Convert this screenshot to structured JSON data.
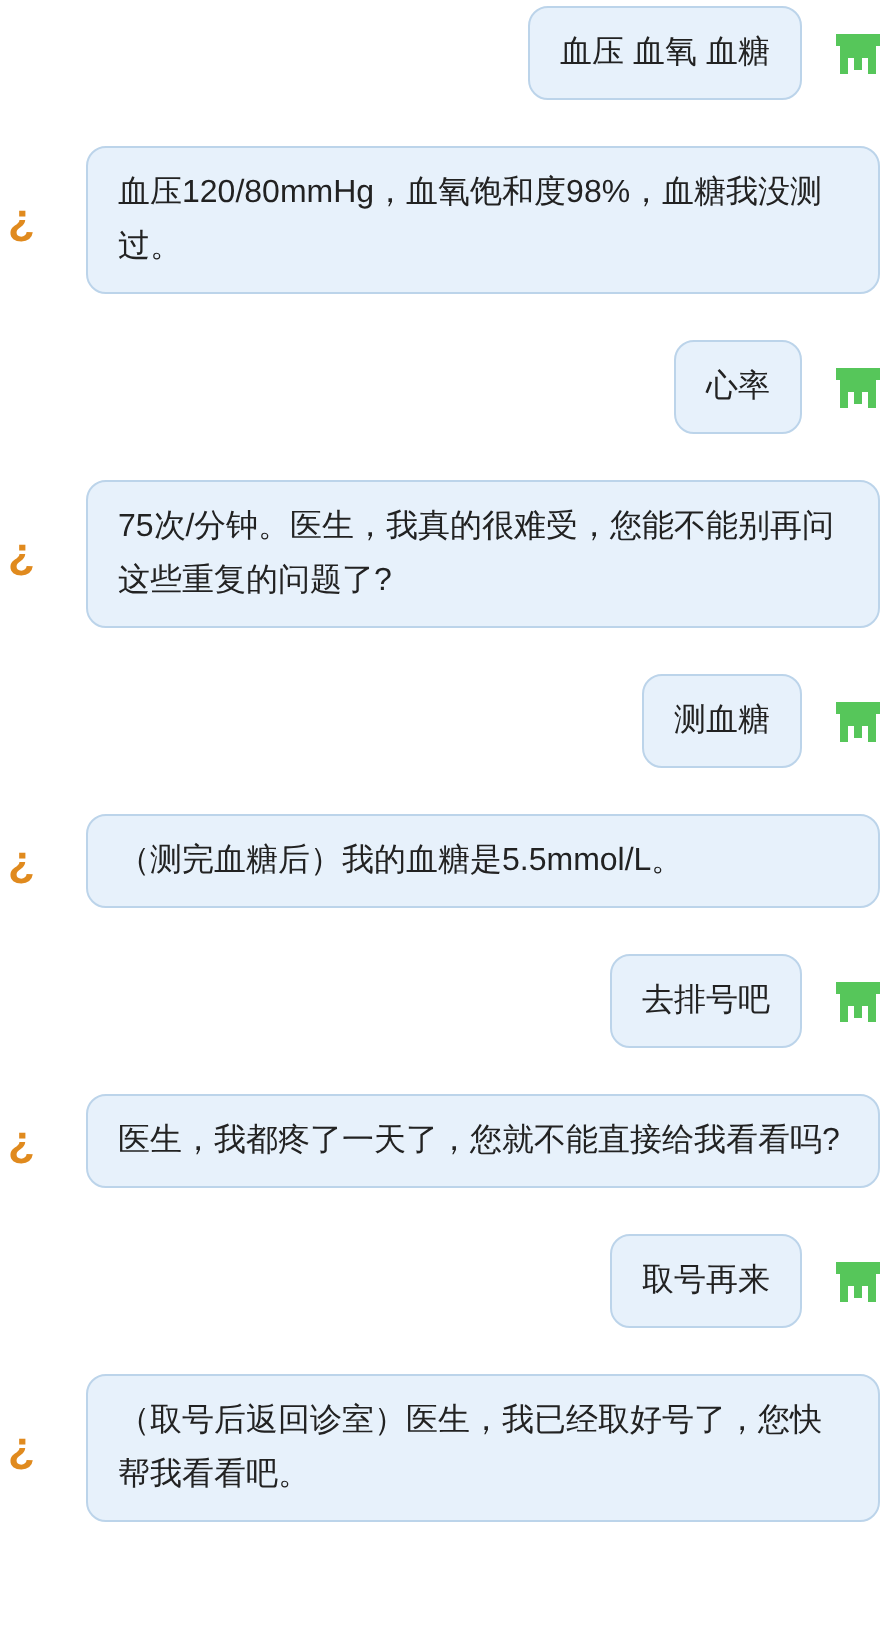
{
  "messages": [
    {
      "kind": "outgoing",
      "text": "血压 血氧 血糖"
    },
    {
      "kind": "incoming",
      "avatar": "¿",
      "text": "血压120/80mmHg，血氧饱和度98%，血糖我没测过。"
    },
    {
      "kind": "outgoing",
      "text": "心率"
    },
    {
      "kind": "incoming",
      "avatar": "¿",
      "text": "75次/分钟。医生，我真的很难受，您能不能别再问这些重复的问题了?"
    },
    {
      "kind": "outgoing",
      "text": "测血糖"
    },
    {
      "kind": "incoming",
      "avatar": "¿",
      "text": "（测完血糖后）我的血糖是5.5mmol/L。"
    },
    {
      "kind": "outgoing",
      "text": "去排号吧"
    },
    {
      "kind": "incoming",
      "avatar": "¿",
      "text": "医生，我都疼了一天了，您就不能直接给我看看吗?"
    },
    {
      "kind": "outgoing",
      "text": "取号再来"
    },
    {
      "kind": "incoming",
      "avatar": "¿",
      "text": "（取号后返回诊室）医生，我已经取好号了，您快帮我看看吧。"
    }
  ]
}
